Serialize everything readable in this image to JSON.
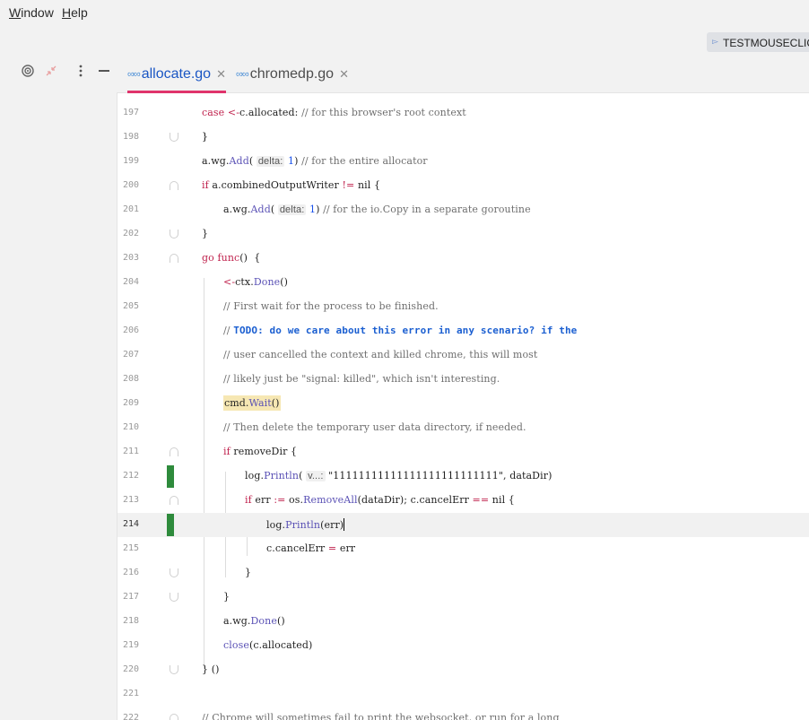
{
  "menu": {
    "window": {
      "mnemonic": "W",
      "rest": "indow"
    },
    "help": {
      "mnemonic": "H",
      "rest": "elp"
    }
  },
  "run_config": {
    "label": "TESTMOUSECLICK"
  },
  "tabs": [
    {
      "label": "allocate.go",
      "active": true
    },
    {
      "label": "chromedp.go",
      "active": false
    }
  ],
  "editor": {
    "current_line": "214",
    "line_numbers": [
      "197",
      "198",
      "199",
      "200",
      "201",
      "202",
      "203",
      "204",
      "205",
      "206",
      "207",
      "208",
      "209",
      "210",
      "211",
      "212",
      "213",
      "214",
      "215",
      "216",
      "217",
      "218",
      "219",
      "220",
      "221",
      "222"
    ],
    "code": {
      "l197": {
        "kw": "case",
        "op": " <-",
        "rest": "c.allocated: ",
        "comment": "// for this browser's root context"
      },
      "l198": {
        "text": "}"
      },
      "l199": {
        "pre": "a.wg.",
        "fn": "Add",
        "open": "( ",
        "hint": "delta:",
        "num": " 1",
        "close": ") ",
        "comment": "// for the entire allocator"
      },
      "l200": {
        "kw": "if",
        "mid": " a.combinedOutputWriter ",
        "op": "!=",
        "rest": " nil {"
      },
      "l201": {
        "pre": "a.wg.",
        "fn": "Add",
        "open": "( ",
        "hint": "delta:",
        "num": " 1",
        "close": ") ",
        "comment": "// for the io.Copy in a separate goroutine"
      },
      "l202": {
        "text": "}"
      },
      "l203": {
        "kw1": "go",
        "kw2": " func",
        "rest": "()  {"
      },
      "l204": {
        "op": "<-",
        "pre": "ctx.",
        "fn": "Done",
        "rest": "()"
      },
      "l205": {
        "comment": "// First wait for the process to be finished."
      },
      "l206": {
        "comment": "// ",
        "todo": "TODO: do we care about this error in any scenario? if the"
      },
      "l207": {
        "comment": "// user cancelled the context and killed chrome, this will most"
      },
      "l208": {
        "comment": "// likely just be \"signal: killed\", which isn't interesting."
      },
      "l209": {
        "pre": "cmd.",
        "fn": "Wait",
        "rest": "()"
      },
      "l210": {
        "comment": "// Then delete the temporary user data directory, if needed."
      },
      "l211": {
        "kw": "if",
        "rest": " removeDir {"
      },
      "l212": {
        "pre": "log.",
        "fn": "Println",
        "open": "( ",
        "hint": "v...:",
        "str": " \"11111111111111111111111111\"",
        "rest": ", dataDir)"
      },
      "l213": {
        "kw": "if",
        "mid": " err ",
        "op1": ":=",
        "mid2": " os.",
        "fn": "RemoveAll",
        "mid3": "(dataDir); c.cancelErr ",
        "op2": "==",
        "rest": " nil {"
      },
      "l214": {
        "pre": "log.",
        "fn": "Println",
        "rest": "(err)"
      },
      "l215": {
        "pre": "c.cancelErr ",
        "op": "=",
        "rest": " err"
      },
      "l216": {
        "text": "}"
      },
      "l217": {
        "text": "}"
      },
      "l218": {
        "pre": "a.wg.",
        "fn": "Done",
        "rest": "()"
      },
      "l219": {
        "fn": "close",
        "rest": "(c.allocated)"
      },
      "l220": {
        "text": "} ()"
      },
      "l221": {
        "text": ""
      },
      "l222": {
        "comment": "// Chrome will sometimes fail to print the websocket, or run for a long"
      }
    }
  },
  "colors": {
    "keyword": "#c0234e",
    "function": "#5a51b5",
    "comment": "#6e6e6e",
    "todo": "#1b5fd1",
    "change_marker": "#2e8b3c",
    "active_tab_underline": "#e0336b"
  },
  "icons": [
    "target-icon",
    "collapse-arrows-icon",
    "more-options-icon",
    "minimize-icon",
    "go-file-icon",
    "close-icon"
  ]
}
